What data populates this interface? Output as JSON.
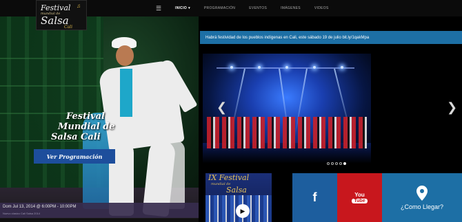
{
  "logo": {
    "line1": "Festival",
    "line2": "mundial de",
    "line3": "Salsa",
    "line4": "Cali"
  },
  "nav": {
    "items": [
      {
        "label": "INICIO",
        "active": true
      },
      {
        "label": "PROGRAMACIÓN",
        "active": false
      },
      {
        "label": "EVENTOS",
        "active": false
      },
      {
        "label": "IMÁGENES",
        "active": false
      },
      {
        "label": "VIDEOS",
        "active": false
      }
    ],
    "menu_icon": "hamburger-icon"
  },
  "hero": {
    "title_line1": "Festival",
    "title_line2": "Mundial de",
    "title_line3": "Salsa Cali",
    "button_label": "Ver Programación",
    "event_date": "Dom Jul 13, 2014 @ 6:00PM - 10:00PM",
    "event_sub": "Nuevo clasico Cali Salsa 2014"
  },
  "news": {
    "text": "Habrá festividad de los pueblos indígenas en Cali, este sábado 19 de julio bit.ly/1qakMpa"
  },
  "slider": {
    "slides_total": 5,
    "active_slide": 5,
    "prev_icon": "chevron-left-icon",
    "next_icon": "chevron-right-icon"
  },
  "poster": {
    "line1": "IX Festival",
    "line2": "mundial de",
    "line3": "Salsa"
  },
  "social": {
    "facebook_glyph": "f",
    "youtube_you": "You",
    "youtube_tube": "Tube",
    "map_label": "¿Como Llegar?"
  },
  "colors": {
    "primary_blue": "#1d6fa5",
    "button_blue": "#1d4e9c",
    "facebook_blue": "#1d5e9e",
    "youtube_red": "#c8171d",
    "event_purple": "#372c4e"
  }
}
